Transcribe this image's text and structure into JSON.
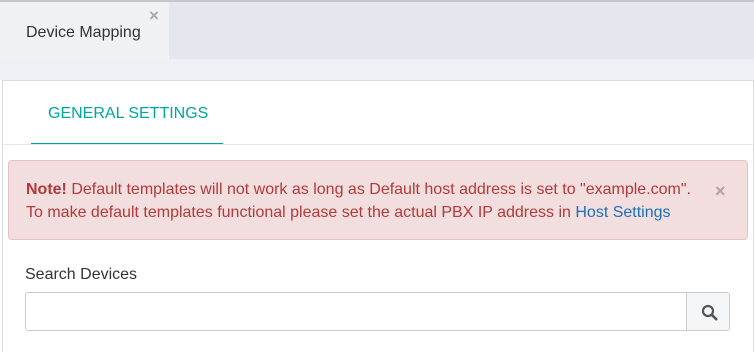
{
  "page_tabs": [
    {
      "label": "Device Mapping",
      "close_icon": "close-icon"
    }
  ],
  "settings_tabs": [
    {
      "label": "GENERAL SETTINGS",
      "active": true
    }
  ],
  "alert": {
    "strong": "Note!",
    "line1": "Default templates will not work as long as Default host address is set to \"example.com\".",
    "line2": "To make default templates functional please set the actual PBX IP address in",
    "link": "Host Settings",
    "close_icon": "close-icon"
  },
  "search": {
    "label": "Search Devices",
    "value": "",
    "placeholder": "",
    "button_icon": "search-icon"
  },
  "colors": {
    "accent": "#00a69c",
    "alert_background": "#f2dede",
    "alert_text": "#b13a3a",
    "link": "#1e70b5"
  }
}
